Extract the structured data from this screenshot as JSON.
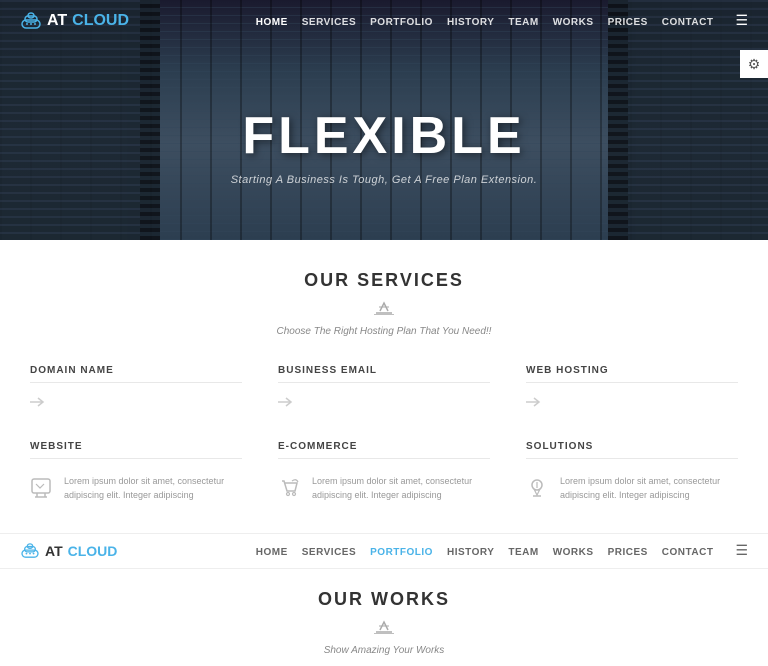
{
  "hero": {
    "title": "FLEXIBLE",
    "subtitle": "Starting A Business Is Tough, Get A Free Plan Extension."
  },
  "nav": {
    "logo_at": "AT",
    "logo_cloud": "CLOUD",
    "links": [
      {
        "label": "HOME",
        "active": true
      },
      {
        "label": "SERVICES",
        "active": false
      },
      {
        "label": "PORTFOLIO",
        "active": false
      },
      {
        "label": "HISTORY",
        "active": false
      },
      {
        "label": "TEAM",
        "active": false
      },
      {
        "label": "WORKS",
        "active": false
      },
      {
        "label": "PRICES",
        "active": false
      },
      {
        "label": "CONTACT",
        "active": false
      }
    ]
  },
  "sticky_nav": {
    "logo_at": "AT",
    "logo_cloud": "CLOUD",
    "links": [
      {
        "label": "HOME",
        "active": false
      },
      {
        "label": "SERVICES",
        "active": false
      },
      {
        "label": "PORTFOLIO",
        "active": true
      },
      {
        "label": "HISTORY",
        "active": false
      },
      {
        "label": "TEAM",
        "active": false
      },
      {
        "label": "WORKS",
        "active": false
      },
      {
        "label": "PRICES",
        "active": false
      },
      {
        "label": "CONTACT",
        "active": false
      }
    ]
  },
  "services": {
    "section_title": "OUR SERVICES",
    "section_subtitle": "Choose The Right Hosting Plan That You Need!!",
    "items": [
      {
        "label": "DOMAIN NAME",
        "icon": "↗",
        "text": ""
      },
      {
        "label": "BUSINESS EMAIL",
        "icon": "↗",
        "text": ""
      },
      {
        "label": "WEB HOSTING",
        "icon": "↗",
        "text": ""
      },
      {
        "label": "WEBSITE",
        "icon": "✎",
        "text": "Lorem ipsum dolor sit amet, consectetur adipiscing elit. Integer adipiscing"
      },
      {
        "label": "E-COMMERCE",
        "icon": "↻",
        "text": "Lorem ipsum dolor sit amet, consectetur adipiscing elit. Integer adipiscing"
      },
      {
        "label": "SOLUTIONS",
        "icon": "↓",
        "text": "Lorem ipsum dolor sit amet, consectetur adipiscing elit. Integer adipiscing"
      }
    ]
  },
  "works": {
    "section_title": "OUR WORKS",
    "section_subtitle": "Show Amazing Your Works"
  }
}
